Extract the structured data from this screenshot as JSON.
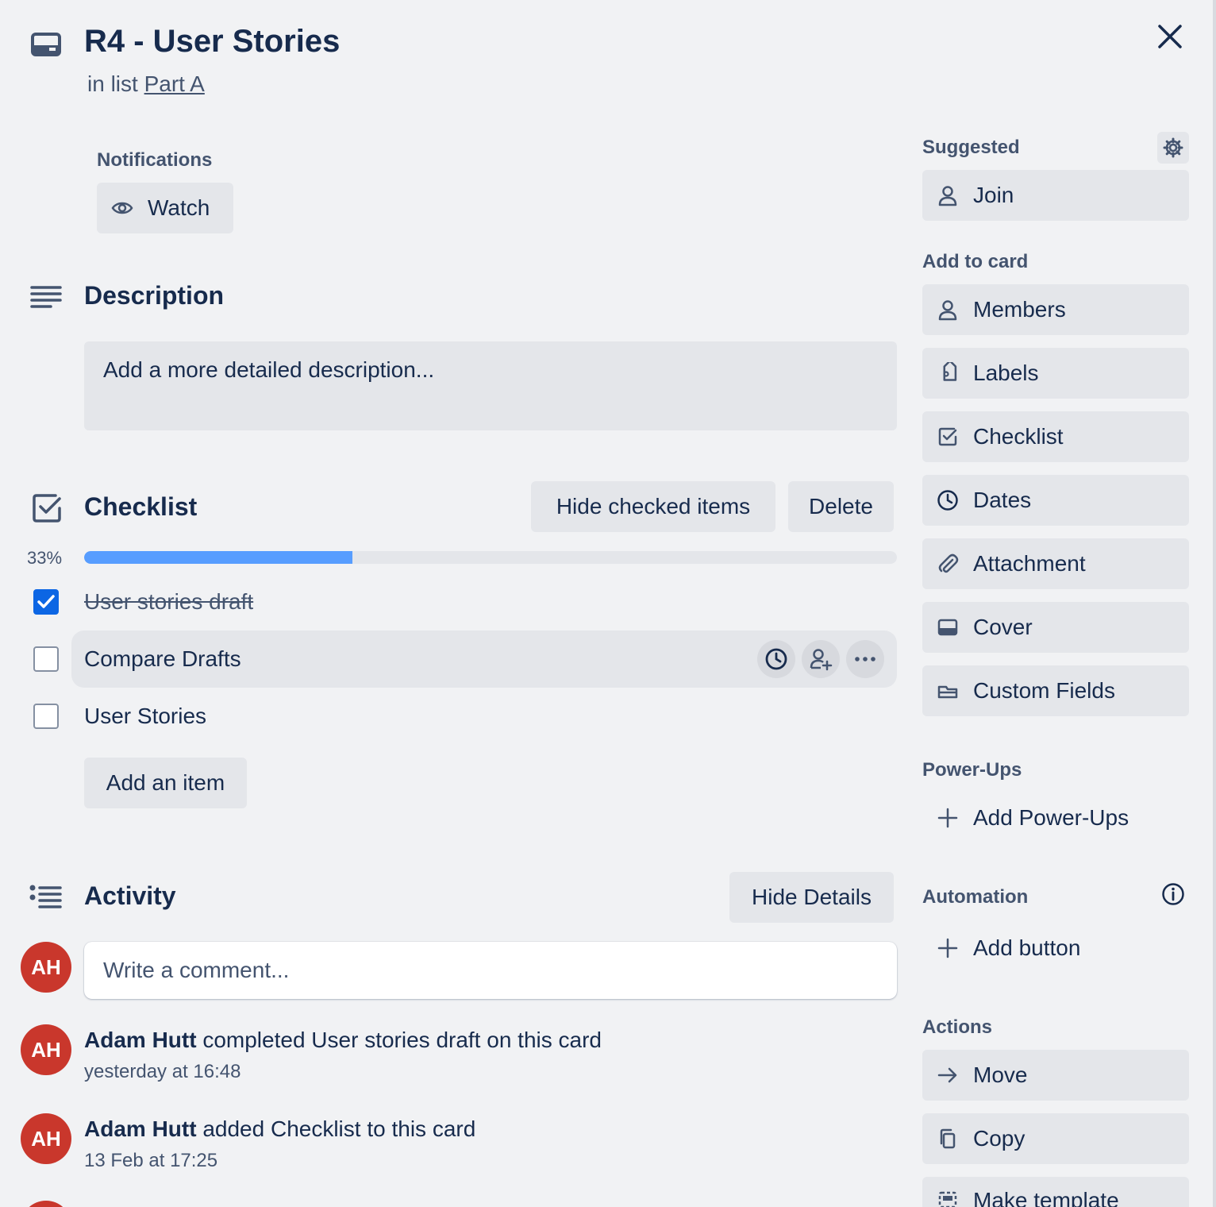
{
  "card": {
    "title": "R4 - User Stories",
    "in_list_prefix": "in list",
    "list_name": "Part A"
  },
  "notifications": {
    "label": "Notifications",
    "watch_label": "Watch"
  },
  "description": {
    "title": "Description",
    "placeholder": "Add a more detailed description..."
  },
  "checklist": {
    "title": "Checklist",
    "hide_checked_label": "Hide checked items",
    "delete_label": "Delete",
    "progress_text": "33%",
    "progress": 0.33,
    "items": [
      {
        "text": "User stories draft",
        "checked": true
      },
      {
        "text": "Compare Drafts",
        "checked": false
      },
      {
        "text": "User Stories",
        "checked": false
      }
    ],
    "add_item_label": "Add an item"
  },
  "activity": {
    "title": "Activity",
    "hide_details_label": "Hide Details",
    "comment_placeholder": "Write a comment...",
    "avatar_initials": "AH",
    "entries": [
      {
        "user": "Adam Hutt",
        "action": "completed User stories draft on this card",
        "time": "yesterday at 16:48"
      },
      {
        "user": "Adam Hutt",
        "action": "added Checklist to this card",
        "time": "13 Feb at 17:25"
      }
    ]
  },
  "sidebar": {
    "suggested_label": "Suggested",
    "join_label": "Join",
    "add_to_card_label": "Add to card",
    "add_to_card": [
      "Members",
      "Labels",
      "Checklist",
      "Dates",
      "Attachment",
      "Cover",
      "Custom Fields"
    ],
    "powerups_label": "Power-Ups",
    "add_powerups_label": "Add Power-Ups",
    "automation_label": "Automation",
    "add_button_label": "Add button",
    "actions_label": "Actions",
    "actions": [
      "Move",
      "Copy",
      "Make template"
    ]
  },
  "colors": {
    "accent": "#0c66e4",
    "progress": "#579dff",
    "avatar": "#c9372c",
    "background": "#f1f2f4"
  }
}
